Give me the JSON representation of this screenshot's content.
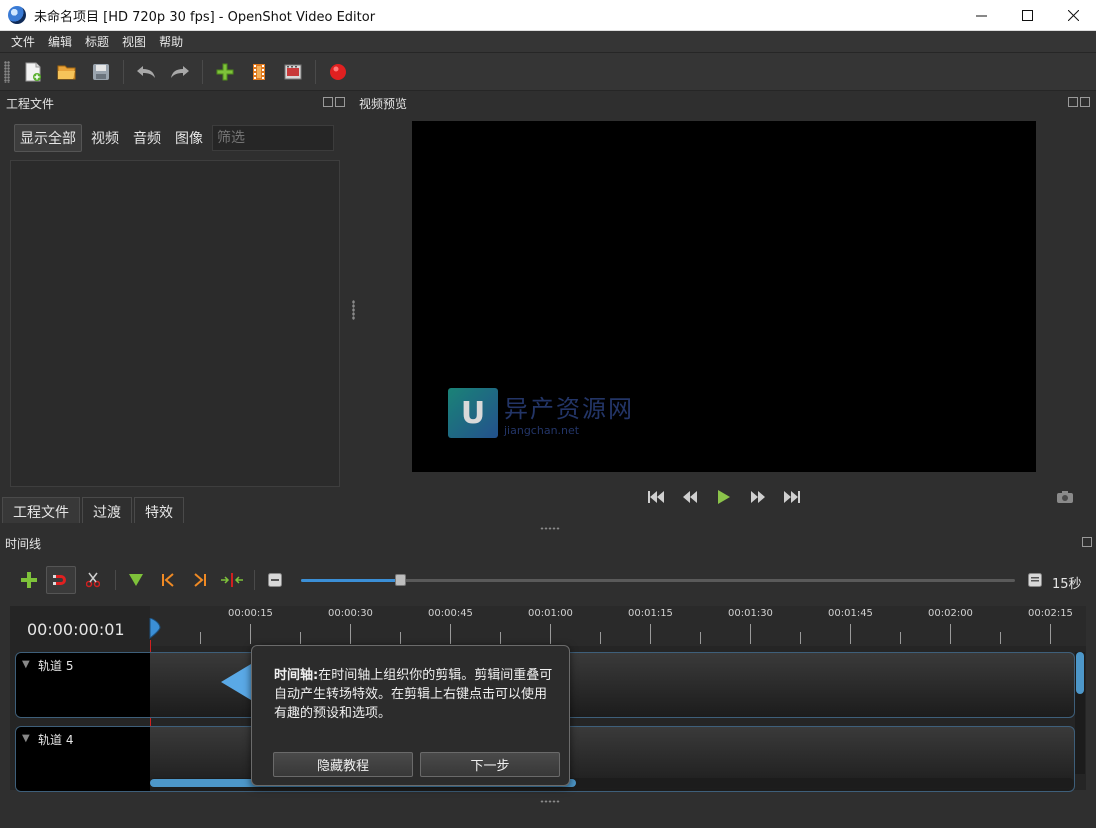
{
  "window": {
    "title": "未命名项目 [HD 720p 30 fps] - OpenShot Video Editor",
    "minimize": "—",
    "maximize": "☐",
    "close": "✕"
  },
  "menu": [
    "文件",
    "编辑",
    "标题",
    "视图",
    "帮助"
  ],
  "toolbar": {
    "icons": [
      "new-project-icon",
      "open-project-icon",
      "save-project-icon",
      "undo-icon",
      "redo-icon",
      "import-files-icon",
      "choose-profile-icon",
      "fullscreen-icon",
      "export-video-icon"
    ]
  },
  "project_files": {
    "title": "工程文件",
    "filters": [
      "显示全部",
      "视频",
      "音频",
      "图像"
    ],
    "filter_placeholder": "筛选",
    "tabs": [
      "工程文件",
      "过渡",
      "特效"
    ]
  },
  "video_preview": {
    "title": "视频预览",
    "watermark_main": "异产资源网",
    "watermark_sub": "jiangchan.net",
    "watermark_logo": "U"
  },
  "timeline": {
    "title": "时间线",
    "current_time": "00:00:00:01",
    "zoom_label": "15秒",
    "zoom_level": 0.14,
    "ticks": [
      "00:00:15",
      "00:00:30",
      "00:00:45",
      "00:01:00",
      "00:01:15",
      "00:01:30",
      "00:01:45",
      "00:02:00",
      "00:02:15"
    ],
    "tracks": [
      "轨道 5",
      "轨道 4"
    ]
  },
  "tutorial": {
    "heading": "时间轴:",
    "body": "在时间轴上组织你的剪辑。剪辑间重叠可自动产生转场特效。在剪辑上右键点击可以使用有趣的预设和选项。",
    "hide_button": "隐藏教程",
    "next_button": "下一步"
  },
  "colors": {
    "accent": "#3b8fd6",
    "playhead": "#d02020",
    "record": "#e02020"
  }
}
